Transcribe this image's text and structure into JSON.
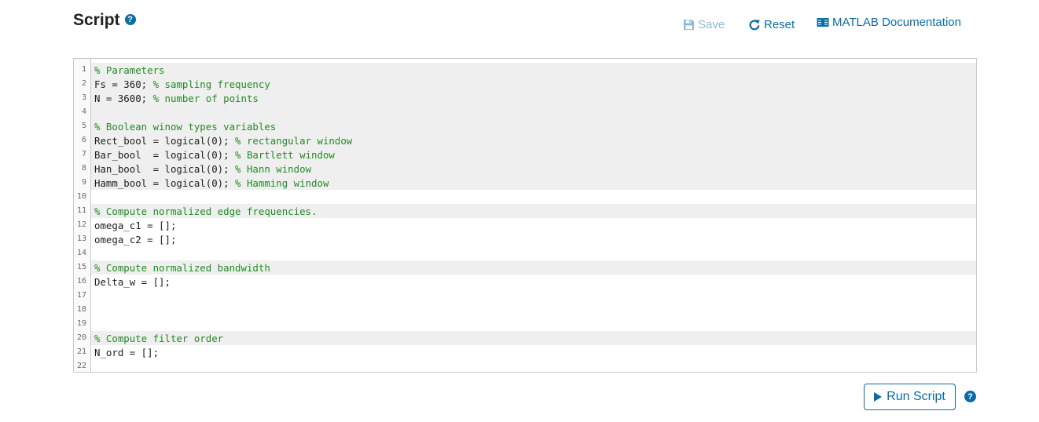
{
  "header": {
    "title": "Script",
    "help_glyph": "?"
  },
  "toolbar": {
    "save_label": "Save",
    "save_icon": "floppy-disk-icon",
    "save_enabled": false,
    "reset_label": "Reset",
    "reset_icon": "refresh-icon",
    "doc_label": "MATLAB Documentation",
    "doc_icon": "book-icon"
  },
  "editor": {
    "lines": [
      {
        "n": "1",
        "code": "",
        "comment": "% Parameters",
        "hl": true
      },
      {
        "n": "2",
        "code": "Fs = 360; ",
        "comment": "% sampling frequency",
        "hl": true
      },
      {
        "n": "3",
        "code": "N = 3600; ",
        "comment": "% number of points",
        "hl": true
      },
      {
        "n": "4",
        "code": "",
        "comment": "",
        "hl": true
      },
      {
        "n": "5",
        "code": "",
        "comment": "% Boolean winow types variables",
        "hl": true
      },
      {
        "n": "6",
        "code": "Rect_bool = logical(0); ",
        "comment": "% rectangular window",
        "hl": true
      },
      {
        "n": "7",
        "code": "Bar_bool  = logical(0); ",
        "comment": "% Bartlett window",
        "hl": true
      },
      {
        "n": "8",
        "code": "Han_bool  = logical(0); ",
        "comment": "% Hann window",
        "hl": true
      },
      {
        "n": "9",
        "code": "Hamm_bool = logical(0); ",
        "comment": "% Hamming window",
        "hl": true
      },
      {
        "n": "10",
        "code": "",
        "comment": "",
        "hl": false
      },
      {
        "n": "11",
        "code": "",
        "comment": "% Compute normalized edge frequencies.",
        "hl": true
      },
      {
        "n": "12",
        "code": "omega_c1 = [];",
        "comment": "",
        "hl": false
      },
      {
        "n": "13",
        "code": "omega_c2 = [];",
        "comment": "",
        "hl": false
      },
      {
        "n": "14",
        "code": "",
        "comment": "",
        "hl": false
      },
      {
        "n": "15",
        "code": "",
        "comment": "% Compute normalized bandwidth",
        "hl": true
      },
      {
        "n": "16",
        "code": "Delta_w = [];",
        "comment": "",
        "hl": false
      },
      {
        "n": "17",
        "code": "",
        "comment": "",
        "hl": false
      },
      {
        "n": "18",
        "code": "",
        "comment": "",
        "hl": false
      },
      {
        "n": "19",
        "code": "",
        "comment": "",
        "hl": false
      },
      {
        "n": "20",
        "code": "",
        "comment": "% Compute filter order",
        "hl": true
      },
      {
        "n": "21",
        "code": "N_ord = [];",
        "comment": "",
        "hl": false
      },
      {
        "n": "22",
        "code": "",
        "comment": "",
        "hl": false
      }
    ]
  },
  "footer": {
    "run_label": "Run Script",
    "run_icon": "play-icon",
    "help_glyph": "?"
  },
  "colors": {
    "accent": "#0a6da3",
    "comment": "#228b22",
    "line_highlight": "#efefef"
  }
}
